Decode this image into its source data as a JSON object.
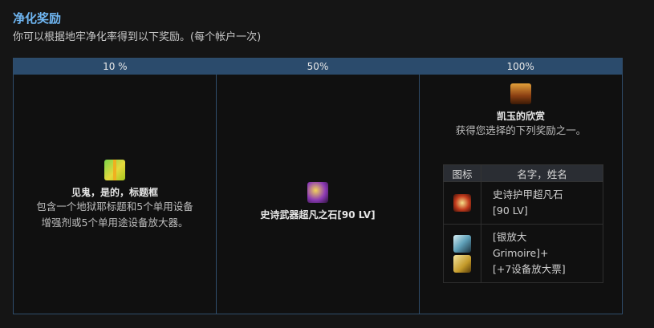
{
  "header": {
    "title": "净化奖励",
    "subtitle": "你可以根据地牢净化率得到以下奖励。(每个帐户一次)"
  },
  "tiers": [
    {
      "label": "10 %"
    },
    {
      "label": "50%"
    },
    {
      "label": "100%"
    }
  ],
  "tier1": {
    "icon": "gift-box-icon",
    "name": "见鬼，是的，标题框",
    "desc_lines": [
      "包含一个地狱耶标题和5个单用设备",
      "增强剂或5个单用途设备放大器。"
    ]
  },
  "tier2": {
    "icon": "epic-weapon-stone-icon",
    "name": "史诗武器超凡之石[90 LV]"
  },
  "tier3": {
    "icon": "treasure-chest-icon",
    "name": "凯玉的欣赏",
    "desc": "获得您选择的下列奖励之一。",
    "table": {
      "col_icon": "图标",
      "col_name": "名字，姓名",
      "rows": [
        {
          "icons": [
            "epic-armor-stone-icon"
          ],
          "lines": [
            "史诗护甲超凡石",
            "[90 LV]"
          ]
        },
        {
          "icons": [
            "grimoire-icon",
            "ticket-icon"
          ],
          "lines": [
            "[银放大",
            "Grimoire]+",
            "[+7设备放大票]"
          ]
        }
      ]
    }
  }
}
